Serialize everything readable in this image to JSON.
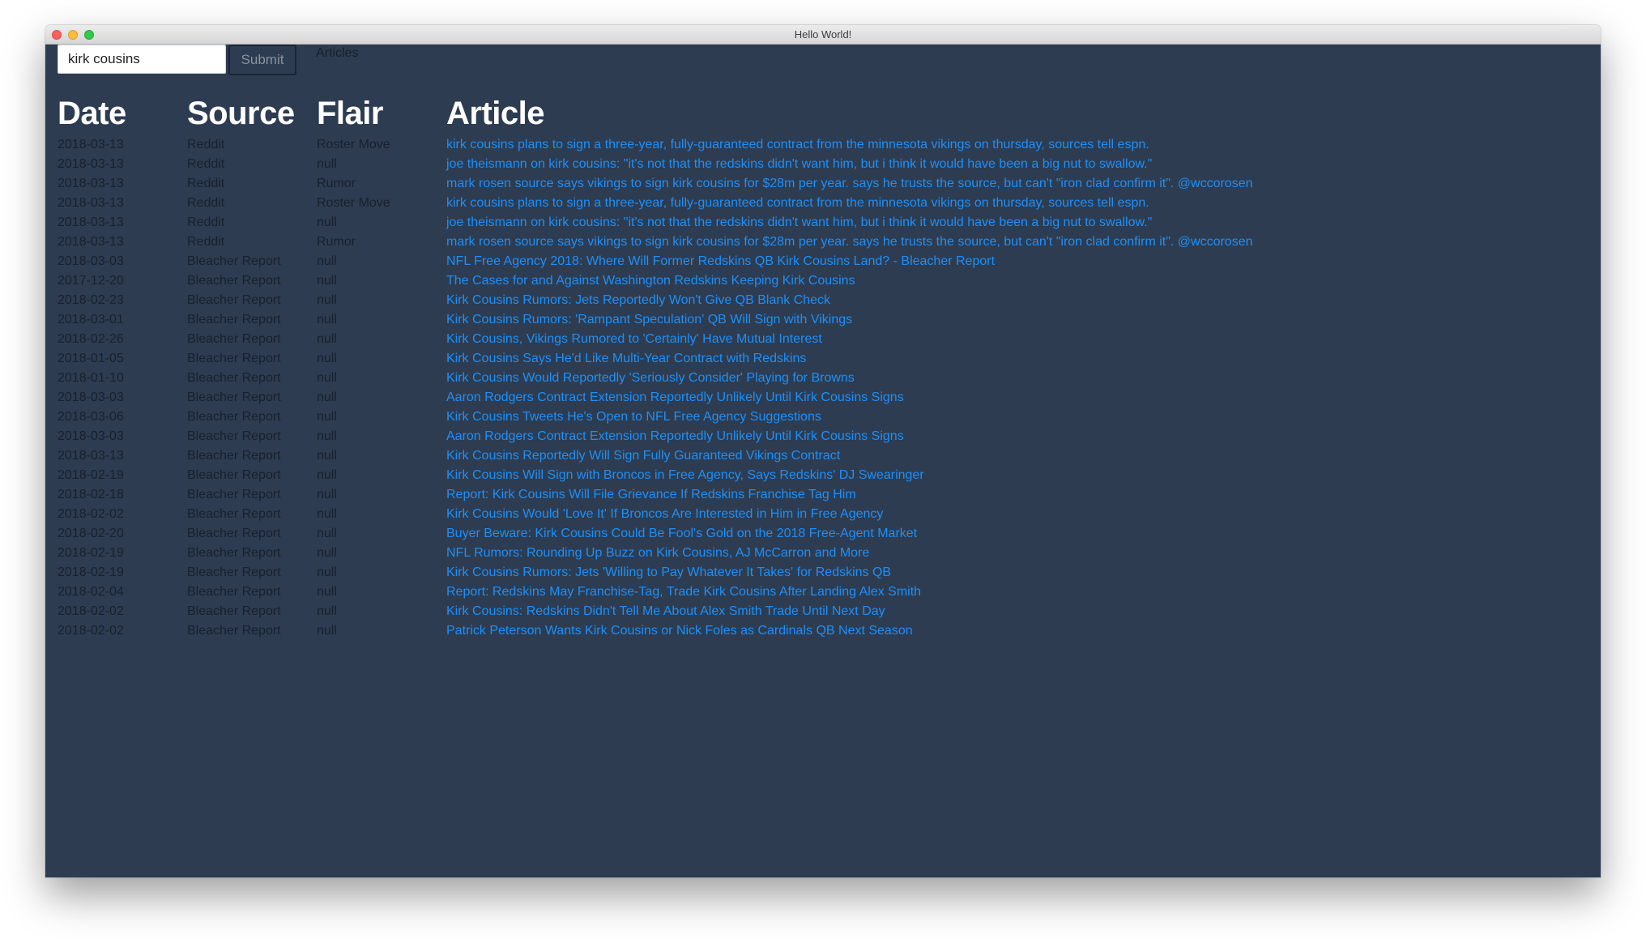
{
  "window": {
    "title": "Hello World!"
  },
  "search": {
    "value": "kirk cousins",
    "submit_label": "Submit"
  },
  "nav": {
    "articles_label": "Articles"
  },
  "table": {
    "headers": {
      "date": "Date",
      "source": "Source",
      "flair": "Flair",
      "article": "Article"
    },
    "rows": [
      {
        "date": "2018-03-13",
        "source": "Reddit",
        "flair": "Roster Move",
        "article": "kirk cousins plans to sign a three-year, fully-guaranteed contract from the minnesota vikings on thursday, sources tell espn."
      },
      {
        "date": "2018-03-13",
        "source": "Reddit",
        "flair": "null",
        "article": "joe theismann on kirk cousins: \"it's not that the redskins didn't want him, but i think it would have been a big nut to swallow.\""
      },
      {
        "date": "2018-03-13",
        "source": "Reddit",
        "flair": "Rumor",
        "article": "mark rosen source says vikings to sign kirk cousins for $28m per year. says he trusts the source, but can't \"iron clad confirm it\". @wccorosen"
      },
      {
        "date": "2018-03-13",
        "source": "Reddit",
        "flair": "Roster Move",
        "article": "kirk cousins plans to sign a three-year, fully-guaranteed contract from the minnesota vikings on thursday, sources tell espn."
      },
      {
        "date": "2018-03-13",
        "source": "Reddit",
        "flair": "null",
        "article": "joe theismann on kirk cousins: \"it's not that the redskins didn't want him, but i think it would have been a big nut to swallow.\""
      },
      {
        "date": "2018-03-13",
        "source": "Reddit",
        "flair": "Rumor",
        "article": "mark rosen source says vikings to sign kirk cousins for $28m per year. says he trusts the source, but can't \"iron clad confirm it\". @wccorosen"
      },
      {
        "date": "2018-03-03",
        "source": "Bleacher Report",
        "flair": "null",
        "article": "NFL Free Agency 2018: Where Will Former Redskins QB Kirk Cousins Land? - Bleacher Report"
      },
      {
        "date": "2017-12-20",
        "source": "Bleacher Report",
        "flair": "null",
        "article": "The Cases for and Against Washington Redskins Keeping Kirk Cousins"
      },
      {
        "date": "2018-02-23",
        "source": "Bleacher Report",
        "flair": "null",
        "article": "Kirk Cousins Rumors: Jets Reportedly Won't Give QB Blank Check"
      },
      {
        "date": "2018-03-01",
        "source": "Bleacher Report",
        "flair": "null",
        "article": "Kirk Cousins Rumors: 'Rampant Speculation' QB Will Sign with Vikings"
      },
      {
        "date": "2018-02-26",
        "source": "Bleacher Report",
        "flair": "null",
        "article": "Kirk Cousins, Vikings Rumored to 'Certainly' Have Mutual Interest"
      },
      {
        "date": "2018-01-05",
        "source": "Bleacher Report",
        "flair": "null",
        "article": "Kirk Cousins Says He'd Like Multi-Year Contract with Redskins"
      },
      {
        "date": "2018-01-10",
        "source": "Bleacher Report",
        "flair": "null",
        "article": "Kirk Cousins Would Reportedly 'Seriously Consider' Playing for Browns"
      },
      {
        "date": "2018-03-03",
        "source": "Bleacher Report",
        "flair": "null",
        "article": "Aaron Rodgers Contract Extension Reportedly Unlikely Until Kirk Cousins Signs"
      },
      {
        "date": "2018-03-06",
        "source": "Bleacher Report",
        "flair": "null",
        "article": "Kirk Cousins Tweets He's Open to NFL Free Agency Suggestions"
      },
      {
        "date": "2018-03-03",
        "source": "Bleacher Report",
        "flair": "null",
        "article": "Aaron Rodgers Contract Extension Reportedly Unlikely Until Kirk Cousins Signs"
      },
      {
        "date": "2018-03-13",
        "source": "Bleacher Report",
        "flair": "null",
        "article": "Kirk Cousins Reportedly Will Sign Fully Guaranteed Vikings Contract"
      },
      {
        "date": "2018-02-19",
        "source": "Bleacher Report",
        "flair": "null",
        "article": "Kirk Cousins Will Sign with Broncos in Free Agency, Says Redskins' DJ Swearinger"
      },
      {
        "date": "2018-02-18",
        "source": "Bleacher Report",
        "flair": "null",
        "article": "Report: Kirk Cousins Will File Grievance If Redskins Franchise Tag Him"
      },
      {
        "date": "2018-02-02",
        "source": "Bleacher Report",
        "flair": "null",
        "article": "Kirk Cousins Would 'Love It' If Broncos Are Interested in Him in Free Agency"
      },
      {
        "date": "2018-02-20",
        "source": "Bleacher Report",
        "flair": "null",
        "article": "Buyer Beware: Kirk Cousins Could Be Fool's Gold on the 2018 Free-Agent Market"
      },
      {
        "date": "2018-02-19",
        "source": "Bleacher Report",
        "flair": "null",
        "article": "NFL Rumors: Rounding Up Buzz on Kirk Cousins, AJ McCarron and More"
      },
      {
        "date": "2018-02-19",
        "source": "Bleacher Report",
        "flair": "null",
        "article": "Kirk Cousins Rumors: Jets 'Willing to Pay Whatever It Takes' for Redskins QB"
      },
      {
        "date": "2018-02-04",
        "source": "Bleacher Report",
        "flair": "null",
        "article": "Report: Redskins May Franchise-Tag, Trade Kirk Cousins After Landing Alex Smith"
      },
      {
        "date": "2018-02-02",
        "source": "Bleacher Report",
        "flair": "null",
        "article": "Kirk Cousins: Redskins Didn't Tell Me About Alex Smith Trade Until Next Day"
      },
      {
        "date": "2018-02-02",
        "source": "Bleacher Report",
        "flair": "null",
        "article": "Patrick Peterson Wants Kirk Cousins or Nick Foles as Cardinals QB Next Season"
      }
    ]
  },
  "colors": {
    "background": "#2d3c51",
    "muted_text": "#18212d",
    "link": "#1e8ff8",
    "header_text": "#ffffff"
  }
}
